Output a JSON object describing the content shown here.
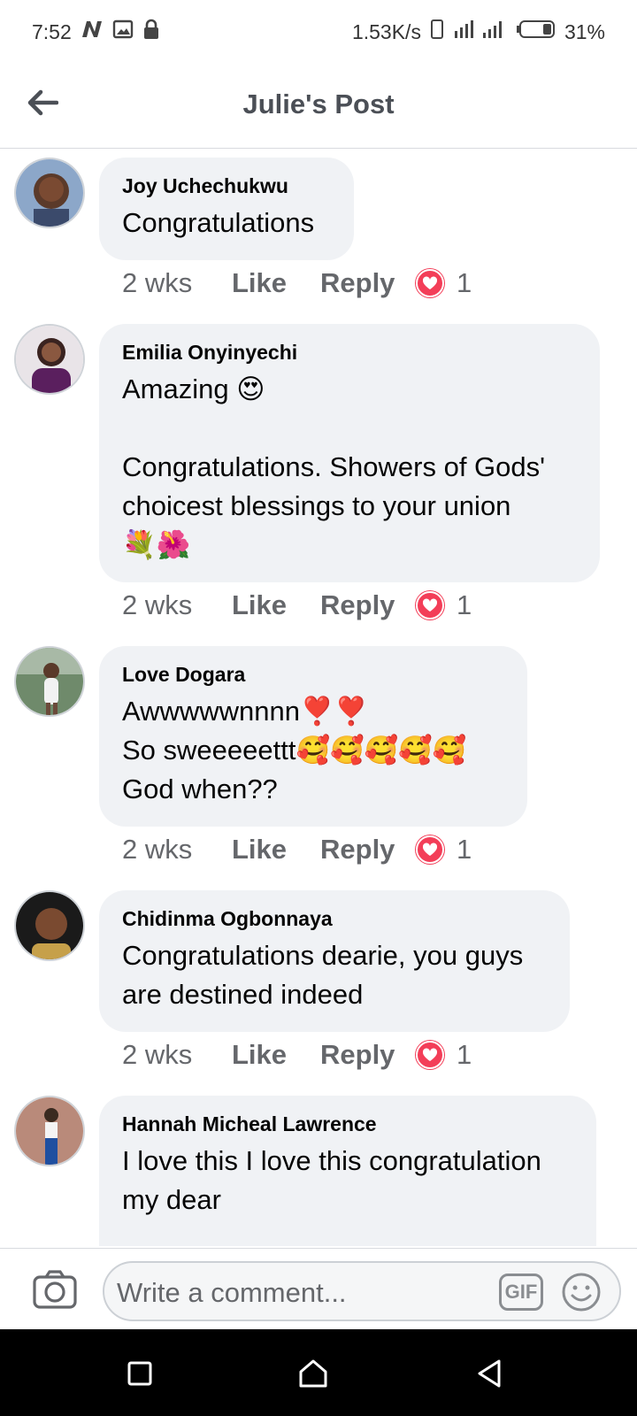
{
  "status_bar": {
    "time": "7:52",
    "speed": "1.53K/s",
    "battery": "31%",
    "icons": [
      "n-notification-icon",
      "image-icon",
      "lock-icon",
      "vibrate-icon",
      "signal-icon",
      "battery-icon"
    ]
  },
  "header": {
    "title": "Julie's Post",
    "back_icon": "arrow-left-icon"
  },
  "comments": [
    {
      "author": "Joy Uchechukwu",
      "text": "Congratulations",
      "time": "2 wks",
      "like_label": "Like",
      "reply_label": "Reply",
      "reaction": "heart",
      "reaction_count": "1"
    },
    {
      "author": "Emilia Onyinyechi",
      "text": "Amazing 😍\n\nCongratulations. Showers of Gods' choicest blessings to your union\n💐🌺",
      "time": "2 wks",
      "like_label": "Like",
      "reply_label": "Reply",
      "reaction": "heart",
      "reaction_count": "1"
    },
    {
      "author": "Love Dogara",
      "text": "Awwwwwnnnn❣️❣️\nSo sweeeeettt🥰🥰🥰🥰🥰\nGod when??",
      "time": "2 wks",
      "like_label": "Like",
      "reply_label": "Reply",
      "reaction": "heart",
      "reaction_count": "1"
    },
    {
      "author": "Chidinma Ogbonnaya",
      "text": "Congratulations dearie, you guys are destined indeed",
      "time": "2 wks",
      "like_label": "Like",
      "reply_label": "Reply",
      "reaction": "heart",
      "reaction_count": "1"
    },
    {
      "author": "Hannah Micheal Lawrence",
      "text": "I love this I love this congratulation my dear",
      "time": "",
      "like_label": "",
      "reply_label": "",
      "reaction": "",
      "reaction_count": ""
    }
  ],
  "composer": {
    "placeholder": "Write a comment...",
    "gif_label": "GIF",
    "camera_icon": "camera-icon",
    "emoji_icon": "smiley-icon"
  },
  "colors": {
    "bubble": "#f0f2f5",
    "reaction_heart": "#f33e58",
    "meta_text": "#65676b"
  }
}
